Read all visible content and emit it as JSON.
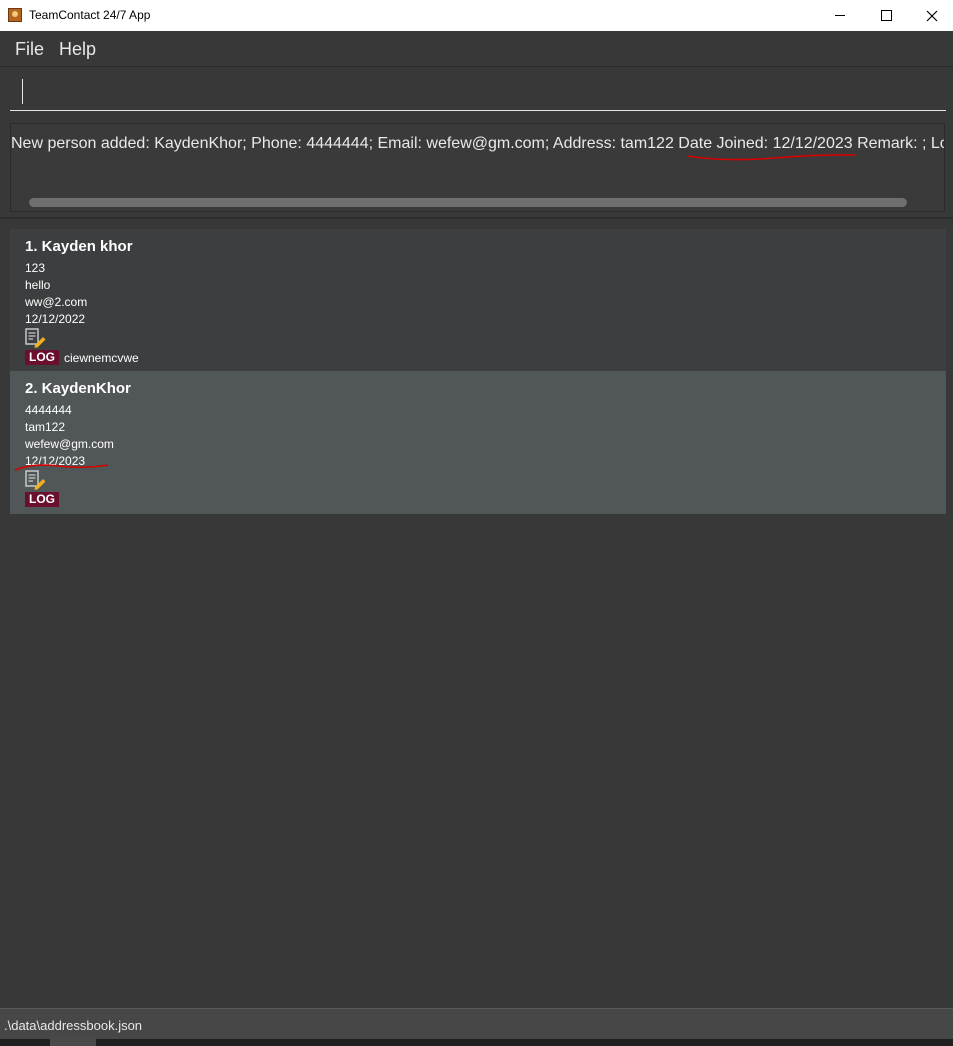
{
  "window": {
    "title": "TeamContact 24/7 App"
  },
  "menu": {
    "file": "File",
    "help": "Help"
  },
  "command": {
    "value": ""
  },
  "result": {
    "text": "New person added: KaydenKhor; Phone: 4444444; Email: wefew@gm.com; Address: tam122 Date Joined: 12/12/2023 Remark: ; Lo"
  },
  "persons": [
    {
      "index_name": "1.  Kayden khor",
      "phone": "123",
      "address": "hello",
      "email": "ww@2.com",
      "date_joined": "12/12/2022",
      "tag": "LOG",
      "remark": "ciewnemcvwe"
    },
    {
      "index_name": "2.  KaydenKhor",
      "phone": "4444444",
      "address": "tam122",
      "email": "wefew@gm.com",
      "date_joined": "12/12/2023",
      "tag": "LOG",
      "remark": ""
    }
  ],
  "status": {
    "file_path": ".\\data\\addressbook.json"
  },
  "colors": {
    "background": "#383838",
    "selected_card": "#515658",
    "tag": "#6b0f2e",
    "annotation": "#d40000"
  },
  "icons": {
    "remark": "edit-note-icon"
  }
}
